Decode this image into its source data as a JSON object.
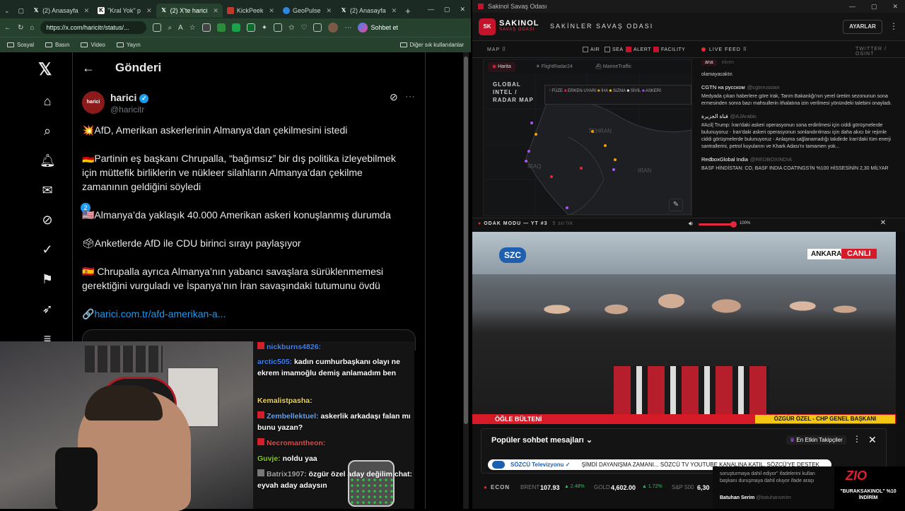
{
  "left_browser": {
    "tabs": [
      {
        "label": "(2) Anasayfa",
        "icon": "x-logo"
      },
      {
        "label": "\"Kral Yok\" p",
        "icon": "kral-yok-favicon"
      },
      {
        "label": "(2) X'te harici",
        "icon": "x-logo",
        "active": true
      },
      {
        "label": "KickPeek",
        "icon": "kickpeek-favicon"
      },
      {
        "label": "GeoPulse",
        "icon": "geopulse-favicon"
      },
      {
        "label": "(2) Anasayfa",
        "icon": "x-logo"
      }
    ],
    "url": "https://x.com/haricitr/status/...",
    "chat_button": "Sohbet et",
    "favorites": [
      "Sosyal",
      "Basın",
      "Video",
      "Yayın"
    ],
    "other_favorites": "Diğer sık kullanılanlar"
  },
  "x_page": {
    "header_title": "Gönderi",
    "notification_count": "2",
    "author_name": "harici",
    "author_handle": "@haricitr",
    "tweet_lines": [
      "💥AfD, Amerikan askerlerinin Almanya’dan çekilmesini istedi",
      "🇩🇪Partinin eş başkanı Chrupalla, “bağımsız” bir dış politika izleyebilmek",
      "için müttefik birliklerin ve nükleer silahların Almanya’dan çekilme",
      "zamanının geldiğini söyledi",
      "🇺🇸Almanya’da yaklaşık 40.000 Amerikan askeri konuşlanmış durumda",
      "🗳Anketlerde AfD ile CDU birinci sırayı paylaşıyor",
      "🇪🇸 Chrupalla ayrıca Almanya’nın yabancı savaşlara sürüklenmemesi",
      "gerektiğini vurguladı ve İspanya’nın İran savaşındaki tutumunu övdü"
    ],
    "link_prefix": "🔗",
    "link_text": "harici.com.tr/afd-amerikan-a..."
  },
  "stream_chat": [
    {
      "user": "nickburns4826:",
      "text": "",
      "color": "#3b82f6"
    },
    {
      "user": "arctic505:",
      "text": "kadın cumhurbaşkanı olayı ne ekrem imamoğlu demiş anlamadım ben",
      "color": "#3b82f6"
    },
    {
      "user": "Kemalistpasha:",
      "text": "",
      "color": "#f2d44b"
    },
    {
      "user": "Zembellektuel:",
      "text": "askerlik arkadaşı falan mı bunu yazan?",
      "color": "#60a5fa"
    },
    {
      "user": "Necromantheon:",
      "text": "",
      "color": "#ef4444"
    },
    {
      "user": "Guvje:",
      "text": "noldu yaa",
      "color": "#84cc16"
    },
    {
      "user": "Batrix1907:",
      "text": "özgür özel aday değilim chat: eyvah aday adaysın",
      "color": "#a3a3a3"
    }
  ],
  "right_app": {
    "window_title": "Sakinol Savaş Odası",
    "brand": "SAKINOL",
    "brand_sub": "SAVAŞ ODASI",
    "app_title": "SAKİNLER SAVAŞ ODASI",
    "settings_label": "AYARLAR",
    "map_label": "MAP ⠿",
    "filters": [
      {
        "label": "AIR",
        "checked": false
      },
      {
        "label": "SEA",
        "checked": false
      },
      {
        "label": "ALERT",
        "checked": true
      },
      {
        "label": "FACILITY",
        "checked": true
      }
    ],
    "live_feed_label": "LIVE FEED ⠿",
    "feed_sources_label": "TWITTER / OSINT",
    "map_tabs": [
      "Harita",
      "FlightRadar24",
      "MarineTraffic"
    ],
    "map_title": "GLOBAL INTEL / RADAR MAP",
    "legend": [
      "FÜZE",
      "ERKEN UYARI",
      "İHA",
      "SIZMA",
      "SİVİL",
      "ASKERİ"
    ],
    "map_places": [
      "TEHRAN",
      "IRAQ",
      "IRAN"
    ],
    "feed_tabs": [
      "ana",
      "ekren"
    ],
    "feed": [
      {
        "source": "",
        "handle": "",
        "text": "olamayacaktır."
      },
      {
        "source": "CGTN на русском",
        "handle": "@cgtnrussian",
        "text": "Medyada çıkan haberlere göre Irak, Tarım Bakanlığı'nın yerel üretim sezonunun sona ermesinden sonra bazı mahsullerin ithalatına izin verilmesi yönündeki talebini onayladı."
      },
      {
        "source": "قناة الجزيرة",
        "handle": "@AJArabic",
        "text": "#Acil| Trump: İran'daki askeri operasyonun sona erdirilmesi için ciddi görüşmelerde bulunuyoruz - İran'daki askeri operasyonun sonlandırılması için daha akıcı bir rejimle ciddi görüşmelerde bulunuyoruz - Anlaşma sağlanamadığı takdirde İran'daki tüm enerji santrallerini, petrol kuyularını ve Khark Adası'nı tamamen yok..."
      },
      {
        "source": "RedboxGlobal India",
        "handle": "@REDBOXINDIA",
        "text": "BASF HİNDİSTAN: CO, BASF INDIA COATINGS'İN %100 HİSSESİNİN 2,30 MİLYAR"
      }
    ],
    "odak_label": "ODAK MODU — YT #3",
    "odak_extra": "5 sn'lik",
    "volume_label": "100%",
    "volume_level": 1.0,
    "video": {
      "channel_logo": "SZC",
      "location": "ANKARA",
      "live": "CANLI",
      "program": "ÖĞLE BÜLTENİ",
      "person_caption": "ÖZGÜR ÖZEL - CHP GENEL BAŞKANI",
      "mic_brands": [
        "halk tv",
        "AA",
        "SZC",
        "sözcü",
        "NTV",
        "İHA",
        "CNN TÜRK",
        "DHA"
      ]
    },
    "popular_chat_title": "Popüler sohbet mesajları",
    "top_followers_label": "En Etkin Takipçiler",
    "ticker_tag": "SÖZCÜ Televizyonu ✓",
    "ticker_text": "ŞİMDİ DAYANIŞMA ZAMANI... SÖZCÜ TV YOUTUBE KANALINA KATIL, SÖZCÜ'YE DESTEK",
    "econ_label": "ECON",
    "econ": [
      {
        "name": "BRENT",
        "value": "107.93",
        "change": "▲ 2.48%"
      },
      {
        "name": "GOLD",
        "value": "4,602.00",
        "change": "▲ 1.72%"
      },
      {
        "name": "S&P 500",
        "value": "6,30",
        "change": ""
      }
    ],
    "corner_feed_text": "soruşturmaya dahil ediyor\" ifadelerini kullan başkanı duruşmaya dahil oluyor ifade araşı",
    "corner_feed_user": "Batuhan Serim",
    "corner_feed_handle": "@batuhanserim",
    "promo_logo": "ZIO",
    "promo_text": "\"BURAKSAKINOL\" %10 İNDİRİM"
  }
}
